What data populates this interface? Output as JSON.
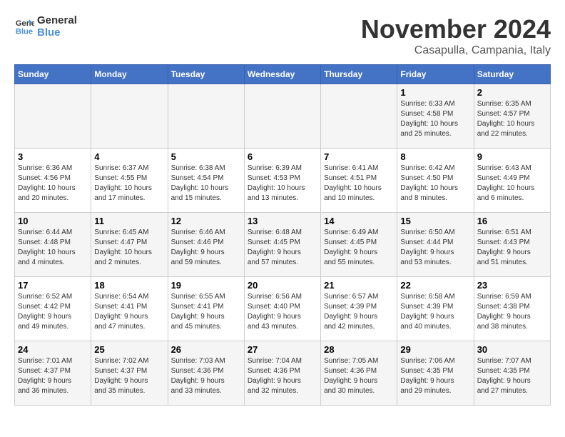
{
  "header": {
    "logo_line1": "General",
    "logo_line2": "Blue",
    "month_title": "November 2024",
    "location": "Casapulla, Campania, Italy"
  },
  "days_of_week": [
    "Sunday",
    "Monday",
    "Tuesday",
    "Wednesday",
    "Thursday",
    "Friday",
    "Saturday"
  ],
  "weeks": [
    [
      {
        "day": "",
        "info": ""
      },
      {
        "day": "",
        "info": ""
      },
      {
        "day": "",
        "info": ""
      },
      {
        "day": "",
        "info": ""
      },
      {
        "day": "",
        "info": ""
      },
      {
        "day": "1",
        "info": "Sunrise: 6:33 AM\nSunset: 4:58 PM\nDaylight: 10 hours\nand 25 minutes."
      },
      {
        "day": "2",
        "info": "Sunrise: 6:35 AM\nSunset: 4:57 PM\nDaylight: 10 hours\nand 22 minutes."
      }
    ],
    [
      {
        "day": "3",
        "info": "Sunrise: 6:36 AM\nSunset: 4:56 PM\nDaylight: 10 hours\nand 20 minutes."
      },
      {
        "day": "4",
        "info": "Sunrise: 6:37 AM\nSunset: 4:55 PM\nDaylight: 10 hours\nand 17 minutes."
      },
      {
        "day": "5",
        "info": "Sunrise: 6:38 AM\nSunset: 4:54 PM\nDaylight: 10 hours\nand 15 minutes."
      },
      {
        "day": "6",
        "info": "Sunrise: 6:39 AM\nSunset: 4:53 PM\nDaylight: 10 hours\nand 13 minutes."
      },
      {
        "day": "7",
        "info": "Sunrise: 6:41 AM\nSunset: 4:51 PM\nDaylight: 10 hours\nand 10 minutes."
      },
      {
        "day": "8",
        "info": "Sunrise: 6:42 AM\nSunset: 4:50 PM\nDaylight: 10 hours\nand 8 minutes."
      },
      {
        "day": "9",
        "info": "Sunrise: 6:43 AM\nSunset: 4:49 PM\nDaylight: 10 hours\nand 6 minutes."
      }
    ],
    [
      {
        "day": "10",
        "info": "Sunrise: 6:44 AM\nSunset: 4:48 PM\nDaylight: 10 hours\nand 4 minutes."
      },
      {
        "day": "11",
        "info": "Sunrise: 6:45 AM\nSunset: 4:47 PM\nDaylight: 10 hours\nand 2 minutes."
      },
      {
        "day": "12",
        "info": "Sunrise: 6:46 AM\nSunset: 4:46 PM\nDaylight: 9 hours\nand 59 minutes."
      },
      {
        "day": "13",
        "info": "Sunrise: 6:48 AM\nSunset: 4:45 PM\nDaylight: 9 hours\nand 57 minutes."
      },
      {
        "day": "14",
        "info": "Sunrise: 6:49 AM\nSunset: 4:45 PM\nDaylight: 9 hours\nand 55 minutes."
      },
      {
        "day": "15",
        "info": "Sunrise: 6:50 AM\nSunset: 4:44 PM\nDaylight: 9 hours\nand 53 minutes."
      },
      {
        "day": "16",
        "info": "Sunrise: 6:51 AM\nSunset: 4:43 PM\nDaylight: 9 hours\nand 51 minutes."
      }
    ],
    [
      {
        "day": "17",
        "info": "Sunrise: 6:52 AM\nSunset: 4:42 PM\nDaylight: 9 hours\nand 49 minutes."
      },
      {
        "day": "18",
        "info": "Sunrise: 6:54 AM\nSunset: 4:41 PM\nDaylight: 9 hours\nand 47 minutes."
      },
      {
        "day": "19",
        "info": "Sunrise: 6:55 AM\nSunset: 4:41 PM\nDaylight: 9 hours\nand 45 minutes."
      },
      {
        "day": "20",
        "info": "Sunrise: 6:56 AM\nSunset: 4:40 PM\nDaylight: 9 hours\nand 43 minutes."
      },
      {
        "day": "21",
        "info": "Sunrise: 6:57 AM\nSunset: 4:39 PM\nDaylight: 9 hours\nand 42 minutes."
      },
      {
        "day": "22",
        "info": "Sunrise: 6:58 AM\nSunset: 4:39 PM\nDaylight: 9 hours\nand 40 minutes."
      },
      {
        "day": "23",
        "info": "Sunrise: 6:59 AM\nSunset: 4:38 PM\nDaylight: 9 hours\nand 38 minutes."
      }
    ],
    [
      {
        "day": "24",
        "info": "Sunrise: 7:01 AM\nSunset: 4:37 PM\nDaylight: 9 hours\nand 36 minutes."
      },
      {
        "day": "25",
        "info": "Sunrise: 7:02 AM\nSunset: 4:37 PM\nDaylight: 9 hours\nand 35 minutes."
      },
      {
        "day": "26",
        "info": "Sunrise: 7:03 AM\nSunset: 4:36 PM\nDaylight: 9 hours\nand 33 minutes."
      },
      {
        "day": "27",
        "info": "Sunrise: 7:04 AM\nSunset: 4:36 PM\nDaylight: 9 hours\nand 32 minutes."
      },
      {
        "day": "28",
        "info": "Sunrise: 7:05 AM\nSunset: 4:36 PM\nDaylight: 9 hours\nand 30 minutes."
      },
      {
        "day": "29",
        "info": "Sunrise: 7:06 AM\nSunset: 4:35 PM\nDaylight: 9 hours\nand 29 minutes."
      },
      {
        "day": "30",
        "info": "Sunrise: 7:07 AM\nSunset: 4:35 PM\nDaylight: 9 hours\nand 27 minutes."
      }
    ]
  ]
}
